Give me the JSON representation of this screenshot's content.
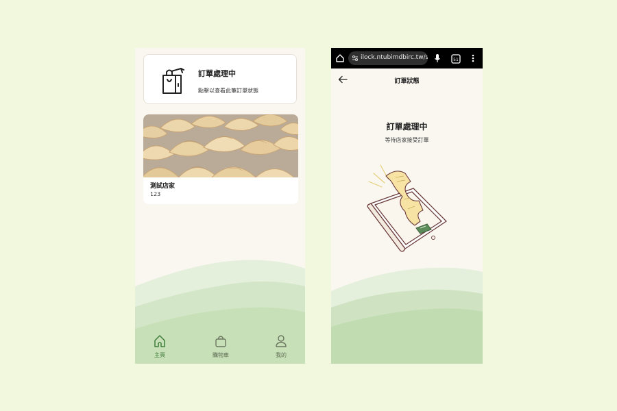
{
  "home": {
    "order_card": {
      "title": "訂單處理中",
      "subtitle": "點擊以查看此筆訂單狀態",
      "icon": "shopping-bag-icon"
    },
    "store": {
      "name": "測試店家",
      "description": "123",
      "photo": "dumplings-photo"
    },
    "nav": {
      "items": [
        {
          "label": "主頁",
          "icon": "home-icon",
          "active": true
        },
        {
          "label": "購物車",
          "icon": "bag-icon",
          "active": false
        },
        {
          "label": "我的",
          "icon": "user-icon",
          "active": false
        }
      ]
    }
  },
  "status_page": {
    "browser": {
      "url": "ilock.ntubimdbirc.tw/s",
      "tab_count": "51"
    },
    "header": {
      "title": "訂單狀態"
    },
    "status": {
      "title": "訂單處理中",
      "subtitle": "等待店家接受訂單"
    }
  },
  "colors": {
    "background": "#f1f8de",
    "screen": "#faf7f1",
    "accent_green": "#3f7d3a",
    "wave_light": "#e2efd9",
    "wave_mid": "#cfe3c2",
    "wave_dark": "#c0dbb0",
    "illus_paper": "#f7e3a4",
    "illus_outline": "#6b3b3b"
  }
}
